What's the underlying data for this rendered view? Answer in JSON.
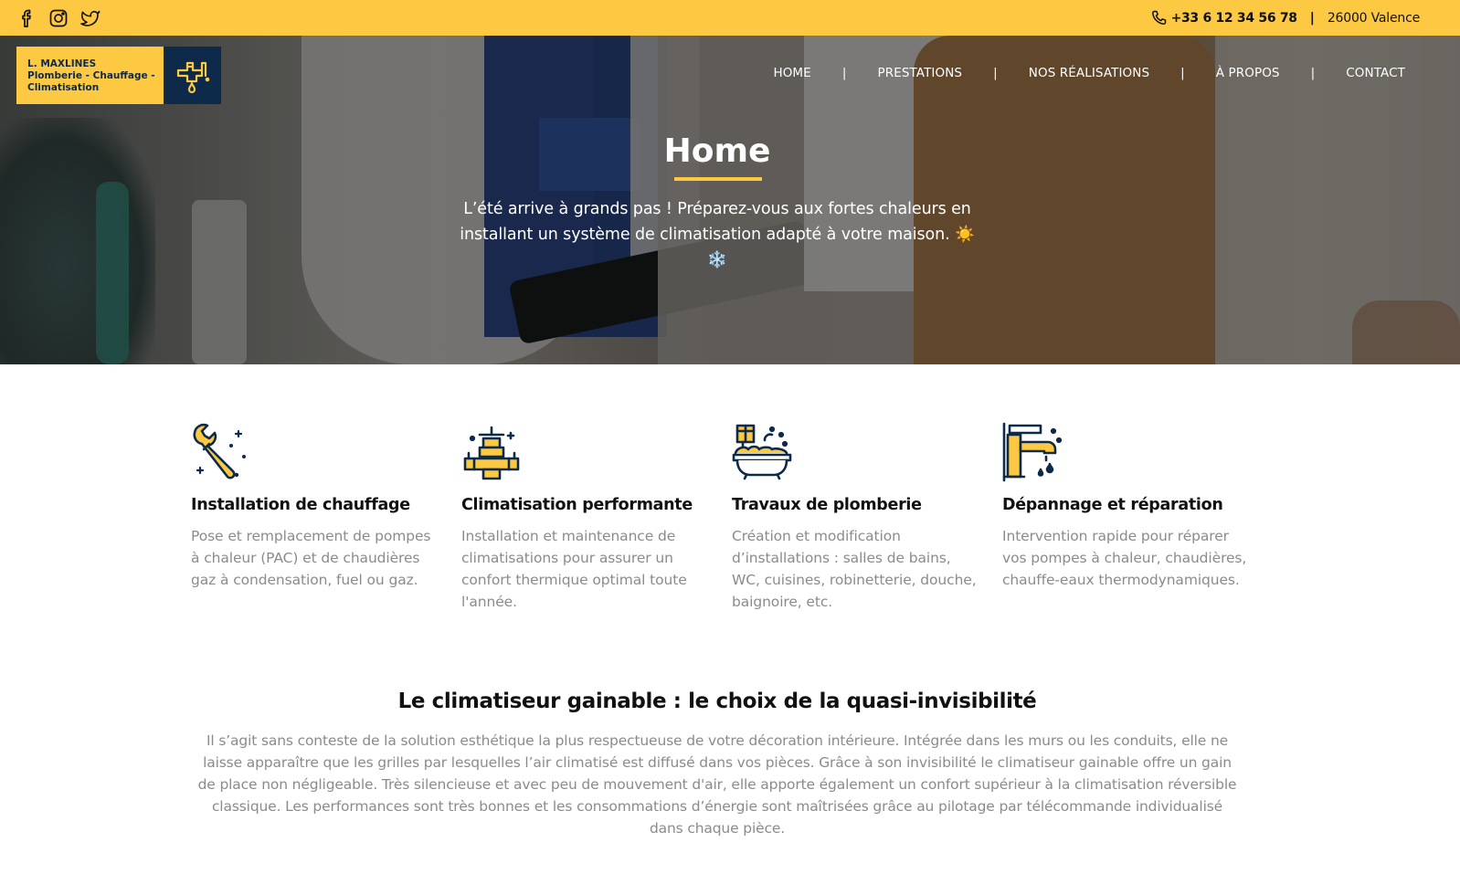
{
  "topbar": {
    "social": [
      "facebook-icon",
      "instagram-icon",
      "twitter-icon"
    ],
    "phone": "+33 6 12 34 56 78",
    "separator": "|",
    "city": "26000 Valence"
  },
  "logo": {
    "line1": "L. MAXLINES",
    "line2": "Plomberie - Chauffage -",
    "line3": "Climatisation"
  },
  "nav": {
    "items": [
      "HOME",
      "PRESTATIONS",
      "NOS RÉALISATIONS",
      "À PROPOS",
      "CONTACT"
    ],
    "separator": "|"
  },
  "hero": {
    "title": "Home",
    "text": "L’été arrive à grands pas ! Préparez-vous aux fortes chaleurs en installant un système de climatisation adapté à votre maison. ☀️❄️"
  },
  "services": [
    {
      "icon": "wrench-icon",
      "title": "Installation de chauffage",
      "text": "Pose et remplacement de pompes à chaleur (PAC) et de chaudières gaz à condensation, fuel ou gaz."
    },
    {
      "icon": "valve-pipe-icon",
      "title": "Climatisation performante",
      "text": "Installation et maintenance de climatisations pour assurer un confort thermique optimal toute l'année."
    },
    {
      "icon": "bathtub-icon",
      "title": "Travaux de plomberie",
      "text": "Création et modification d’installations : salles de bains, WC, cuisines, robinetterie, douche, baignoire, etc."
    },
    {
      "icon": "faucet-icon",
      "title": "Dépannage et réparation",
      "text": "Intervention rapide pour réparer vos pompes à chaleur, chaudières, chauffe-eaux thermodynamiques."
    }
  ],
  "section": {
    "title": "Le climatiseur gainable : le choix de la quasi-invisibilité",
    "text": "Il s’agit sans conteste de la solution esthétique la plus respectueuse de votre décoration intérieure. Intégrée dans les murs ou les conduits, elle ne laisse apparaître que les grilles par lesquelles l’air climatisé est diffusé dans vos pièces. Grâce à son invisibilité le climatiseur gainable offre un gain de place non négligeable. Très silencieuse et avec peu de mouvement d'air, elle apporte également un confort supérieur à la climatisation réversible classique. Les performances sont très bonnes et les consommations d’énergie sont maîtrisées grâce au pilotage par télécommande individualisé dans chaque pièce."
  },
  "colors": {
    "accent": "#fdc942",
    "navy": "#0d2a4a",
    "body_text": "#8b8b8b"
  }
}
